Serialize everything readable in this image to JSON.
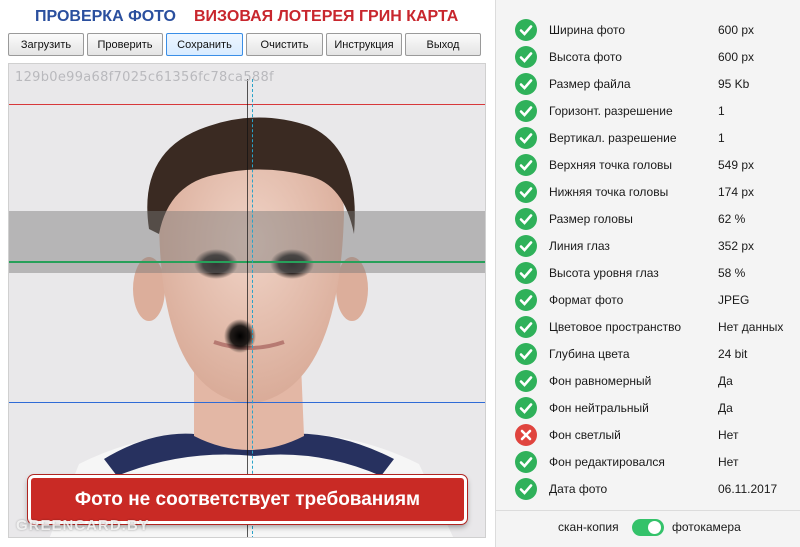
{
  "header": {
    "title_check": "ПРОВЕРКА ФОТО",
    "title_lottery": "ВИЗОВАЯ ЛОТЕРЕЯ ГРИН КАРТА"
  },
  "toolbar": {
    "buttons": [
      {
        "label": "Загрузить"
      },
      {
        "label": "Проверить"
      },
      {
        "label": "Сохранить"
      },
      {
        "label": "Очистить"
      },
      {
        "label": "Инструкция"
      },
      {
        "label": "Выход"
      }
    ]
  },
  "photo": {
    "hash": "129b0e99a68f7025c61356fc78ca588f",
    "verdict": "Фото не соответствует требованиям",
    "watermark": "GREENCARD.BY"
  },
  "checks": [
    {
      "label": "Ширина фото",
      "value": "600 px",
      "status": "ok"
    },
    {
      "label": "Высота фото",
      "value": "600 px",
      "status": "ok"
    },
    {
      "label": "Размер файла",
      "value": "95 Kb",
      "status": "ok"
    },
    {
      "label": "Горизонт. разрешение",
      "value": "1",
      "status": "ok"
    },
    {
      "label": "Вертикал. разрешение",
      "value": "1",
      "status": "ok"
    },
    {
      "label": "Верхняя точка головы",
      "value": "549 px",
      "status": "ok"
    },
    {
      "label": "Нижняя точка головы",
      "value": "174 px",
      "status": "ok"
    },
    {
      "label": "Размер головы",
      "value": "62 %",
      "status": "ok"
    },
    {
      "label": "Линия глаз",
      "value": "352 px",
      "status": "ok"
    },
    {
      "label": "Высота уровня глаз",
      "value": "58 %",
      "status": "ok"
    },
    {
      "label": "Формат фото",
      "value": "JPEG",
      "status": "ok"
    },
    {
      "label": "Цветовое пространство",
      "value": "Нет данных",
      "status": "ok"
    },
    {
      "label": "Глубина цвета",
      "value": "24 bit",
      "status": "ok"
    },
    {
      "label": "Фон равномерный",
      "value": "Да",
      "status": "ok"
    },
    {
      "label": "Фон нейтральный",
      "value": "Да",
      "status": "ok"
    },
    {
      "label": "Фон светлый",
      "value": "Нет",
      "status": "fail"
    },
    {
      "label": "Фон редактировался",
      "value": "Нет",
      "status": "ok"
    },
    {
      "label": "Дата фото",
      "value": "06.11.2017",
      "status": "ok"
    }
  ],
  "source_toggle": {
    "left_label": "скан-копия",
    "right_label": "фотокамера",
    "selected": "фотокамера"
  },
  "colors": {
    "ok": "#2fb15a",
    "fail": "#e0443e",
    "brand_blue": "#2a4f9e",
    "brand_red": "#c8262d"
  }
}
